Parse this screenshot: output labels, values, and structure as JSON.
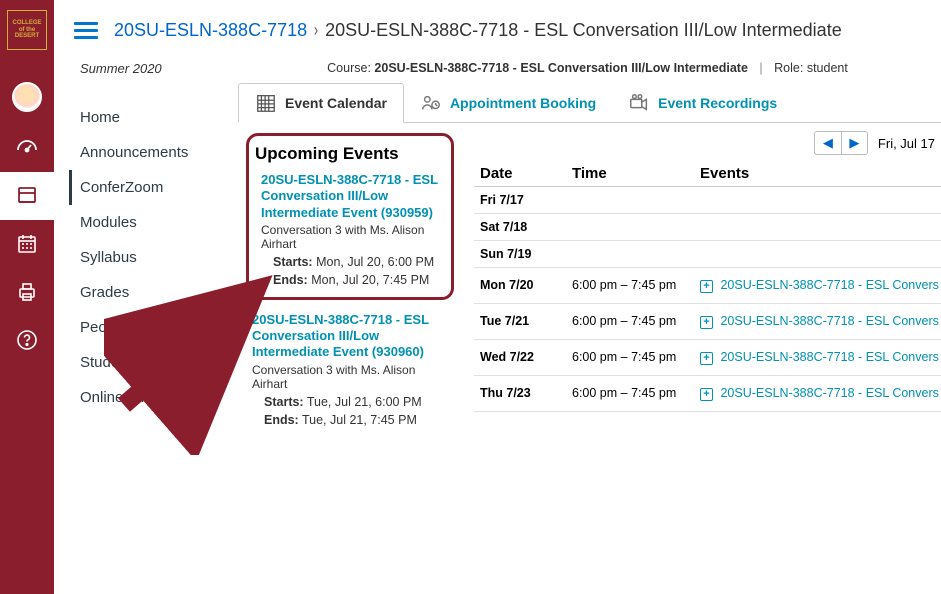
{
  "rail": {
    "logo_text": "COLLEGE of the DESERT"
  },
  "breadcrumb": {
    "course": "20SU-ESLN-388C-7718",
    "sep": "›",
    "title": "20SU-ESLN-388C-7718 - ESL Conversation III/Low Intermediate"
  },
  "course_nav": {
    "term": "Summer 2020",
    "items": [
      {
        "label": "Home"
      },
      {
        "label": "Announcements"
      },
      {
        "label": "ConferZoom"
      },
      {
        "label": "Modules"
      },
      {
        "label": "Syllabus"
      },
      {
        "label": "Grades"
      },
      {
        "label": "People"
      },
      {
        "label": "Student Services"
      },
      {
        "label": "Online Tutoring"
      }
    ]
  },
  "course_role": {
    "course_prefix": "Course:",
    "course": "20SU-ESLN-388C-7718 - ESL Conversation III/Low Intermediate",
    "role_prefix": "Role:",
    "role": "student"
  },
  "tabs": {
    "calendar": "Event Calendar",
    "booking": "Appointment Booking",
    "recordings": "Event Recordings"
  },
  "upcoming": {
    "heading": "Upcoming Events",
    "events": [
      {
        "title": "20SU-ESLN-388C-7718 - ESL Conversation III/Low Intermediate Event (930959)",
        "sub": "Conversation 3 with Ms. Alison Airhart",
        "starts_label": "Starts:",
        "starts": "Mon, Jul 20, 6:00 PM",
        "ends_label": "Ends:",
        "ends": "Mon, Jul 20, 7:45 PM"
      },
      {
        "title": "20SU-ESLN-388C-7718 - ESL Conversation III/Low Intermediate Event (930960)",
        "sub": "Conversation 3 with Ms. Alison Airhart",
        "starts_label": "Starts:",
        "starts": "Tue, Jul 21, 6:00 PM",
        "ends_label": "Ends:",
        "ends": "Tue, Jul 21, 7:45 PM"
      }
    ]
  },
  "week": {
    "date_label": "Fri, Jul 17",
    "head": {
      "date": "Date",
      "time": "Time",
      "events": "Events"
    },
    "rows": [
      {
        "date": "Fri 7/17",
        "time": "",
        "event": ""
      },
      {
        "date": "Sat 7/18",
        "time": "",
        "event": ""
      },
      {
        "date": "Sun 7/19",
        "time": "",
        "event": ""
      },
      {
        "date": "Mon 7/20",
        "time": "6:00 pm – 7:45 pm",
        "event": "20SU-ESLN-388C-7718 - ESL Convers"
      },
      {
        "date": "Tue 7/21",
        "time": "6:00 pm – 7:45 pm",
        "event": "20SU-ESLN-388C-7718 - ESL Convers"
      },
      {
        "date": "Wed 7/22",
        "time": "6:00 pm – 7:45 pm",
        "event": "20SU-ESLN-388C-7718 - ESL Convers"
      },
      {
        "date": "Thu 7/23",
        "time": "6:00 pm – 7:45 pm",
        "event": "20SU-ESLN-388C-7718 - ESL Convers"
      }
    ]
  }
}
